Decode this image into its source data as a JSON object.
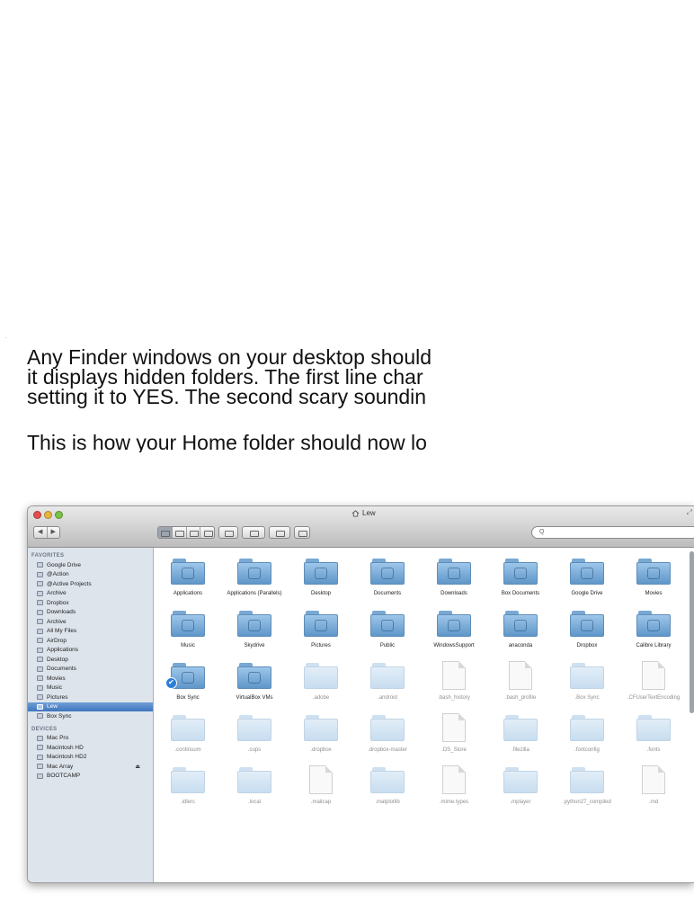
{
  "article": {
    "mark": ".",
    "line1": "Any Finder windows on your desktop should",
    "line2": "it displays hidden folders. The first line char",
    "line3": "setting it to YES. The second scary soundin",
    "line4": "This is how your Home folder should now lo"
  },
  "window": {
    "title": "Lew",
    "resize_glyph": "⤢",
    "search_placeholder": "Q",
    "nav_back": "◀",
    "nav_forward": "▶"
  },
  "sidebar": {
    "favorites_header": "FAVORITES",
    "favorites": [
      {
        "label": "Google Drive"
      },
      {
        "label": "@Action"
      },
      {
        "label": "@Active Projects"
      },
      {
        "label": "Archive"
      },
      {
        "label": "Dropbox"
      },
      {
        "label": "Downloads"
      },
      {
        "label": "Archive"
      },
      {
        "label": "All My Files"
      },
      {
        "label": "AirDrop"
      },
      {
        "label": "Applications"
      },
      {
        "label": "Desktop"
      },
      {
        "label": "Documents"
      },
      {
        "label": "Movies"
      },
      {
        "label": "Music"
      },
      {
        "label": "Pictures"
      },
      {
        "label": "Lew"
      },
      {
        "label": "Box Sync"
      }
    ],
    "devices_header": "DEVICES",
    "devices": [
      {
        "label": "Mac Pro"
      },
      {
        "label": "Macintosh HD"
      },
      {
        "label": "Macintosh HD2"
      },
      {
        "label": "Mac Array"
      },
      {
        "label": "BOOTCAMP"
      }
    ],
    "eject_glyph": "⏏"
  },
  "items": [
    {
      "label": "Applications",
      "kind": "folder"
    },
    {
      "label": "Applications (Parallels)",
      "kind": "folder"
    },
    {
      "label": "Desktop",
      "kind": "folder"
    },
    {
      "label": "Documents",
      "kind": "folder"
    },
    {
      "label": "Downloads",
      "kind": "folder"
    },
    {
      "label": "Box Documents",
      "kind": "folder"
    },
    {
      "label": "Google Drive",
      "kind": "folder"
    },
    {
      "label": "Movies",
      "kind": "folder"
    },
    {
      "label": "Music",
      "kind": "folder"
    },
    {
      "label": "Skydrive",
      "kind": "folder"
    },
    {
      "label": "Pictures",
      "kind": "folder"
    },
    {
      "label": "Public",
      "kind": "folder"
    },
    {
      "label": "WindowsSupport",
      "kind": "folder"
    },
    {
      "label": "anaconda",
      "kind": "folder"
    },
    {
      "label": "Dropbox",
      "kind": "folder"
    },
    {
      "label": "Calibre Library",
      "kind": "folder"
    },
    {
      "label": "Box Sync",
      "kind": "folder",
      "badge": "✔"
    },
    {
      "label": "VirtualBox VMs",
      "kind": "folder"
    },
    {
      "label": ".adobe",
      "kind": "hidden-folder"
    },
    {
      "label": ".android",
      "kind": "hidden-folder"
    },
    {
      "label": ".bash_history",
      "kind": "hidden-file"
    },
    {
      "label": ".bash_profile",
      "kind": "hidden-file"
    },
    {
      "label": ".Box Sync",
      "kind": "hidden-folder"
    },
    {
      "label": ".CFUserTextEncoding",
      "kind": "hidden-file"
    },
    {
      "label": ".continuum",
      "kind": "hidden-folder"
    },
    {
      "label": ".cups",
      "kind": "hidden-folder"
    },
    {
      "label": ".dropbox",
      "kind": "hidden-folder"
    },
    {
      "label": ".dropbox-master",
      "kind": "hidden-folder"
    },
    {
      "label": ".DS_Store",
      "kind": "hidden-file"
    },
    {
      "label": ".filezilla",
      "kind": "hidden-folder"
    },
    {
      "label": ".fontconfig",
      "kind": "hidden-folder"
    },
    {
      "label": ".fonts",
      "kind": "hidden-folder"
    },
    {
      "label": ".idlerc",
      "kind": "hidden-folder"
    },
    {
      "label": ".local",
      "kind": "hidden-folder"
    },
    {
      "label": ".mailcap",
      "kind": "hidden-file"
    },
    {
      "label": ".matplotlib",
      "kind": "hidden-folder"
    },
    {
      "label": ".mime.types",
      "kind": "hidden-file"
    },
    {
      "label": ".mplayer",
      "kind": "hidden-folder"
    },
    {
      "label": ".python27_compiled",
      "kind": "hidden-folder"
    },
    {
      "label": ".rnd",
      "kind": "hidden-file"
    }
  ],
  "colors": {
    "folder": "#7fb0dd",
    "hidden_folder": "#d6e7f4",
    "sidebar_bg": "#dde4ec",
    "selection": "#4a7fc4"
  }
}
